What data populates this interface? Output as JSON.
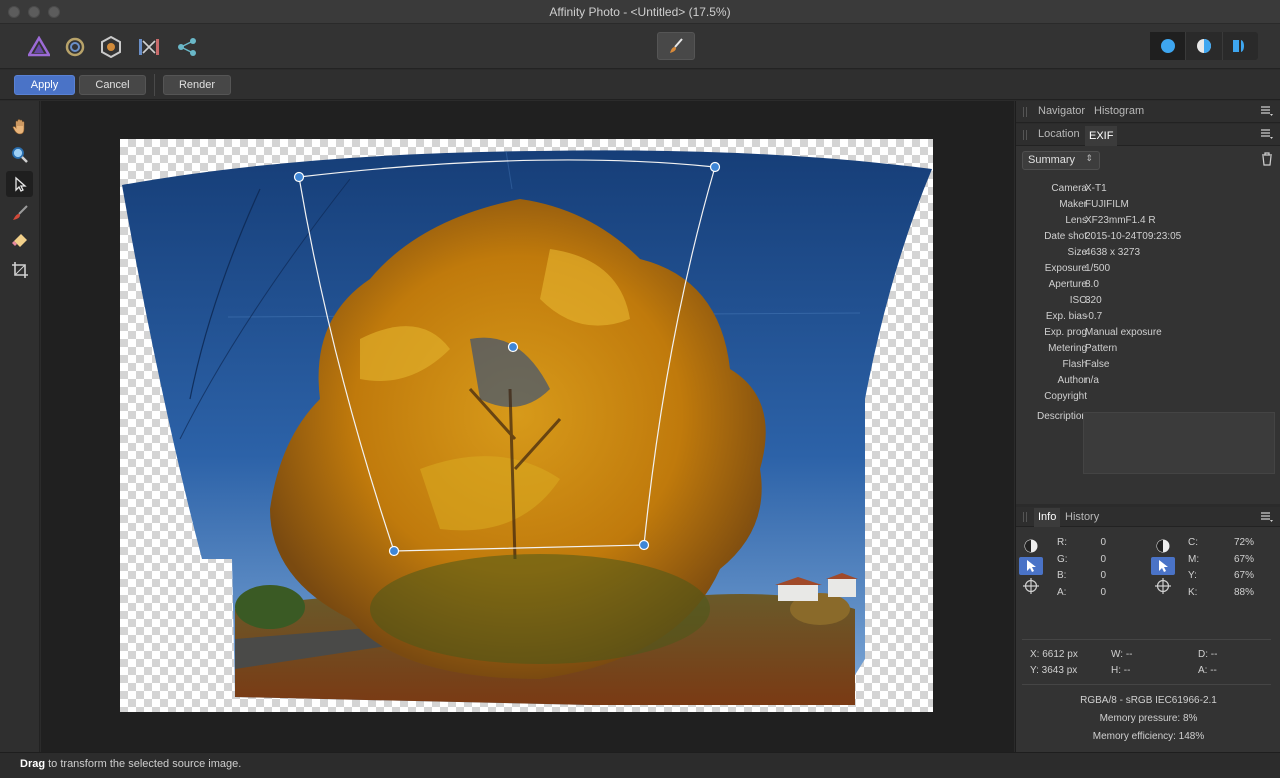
{
  "window": {
    "title": "Affinity Photo - <Untitled> (17.5%)"
  },
  "toolbar": {
    "personas": [
      "photo-persona-icon",
      "liquify-persona-icon",
      "develop-persona-icon",
      "tone-mapping-persona-icon",
      "export-persona-icon"
    ],
    "center_tool_icon": "brush-icon",
    "modes": [
      "single-source-mode-icon",
      "blend-mode-icon",
      "mask-mode-icon"
    ]
  },
  "context_toolbar": {
    "apply_label": "Apply",
    "cancel_label": "Cancel",
    "render_label": "Render"
  },
  "tools": [
    "hand-icon",
    "zoom-icon",
    "move-icon",
    "brush-icon",
    "eraser-icon",
    "crop-icon"
  ],
  "status": {
    "bold": "Drag",
    "text": " to transform the selected source image."
  },
  "panels": {
    "top_tabs": [
      "Navigator",
      "Histogram"
    ],
    "meta_tabs": [
      "Location",
      "EXIF"
    ],
    "summary_select": "Summary",
    "exif": [
      {
        "key": "Camera",
        "value": "X-T1"
      },
      {
        "key": "Maker",
        "value": "FUJIFILM"
      },
      {
        "key": "Lens",
        "value": "XF23mmF1.4 R"
      },
      {
        "key": "Date shot",
        "value": "2015-10-24T09:23:05"
      },
      {
        "key": "Size",
        "value": "4638 x 3273"
      },
      {
        "key": "Exposure",
        "value": "1/500"
      },
      {
        "key": "Aperture",
        "value": "8.0"
      },
      {
        "key": "ISO",
        "value": "320"
      },
      {
        "key": "Exp. bias",
        "value": "-0.7"
      },
      {
        "key": "Exp. prog",
        "value": "Manual exposure"
      },
      {
        "key": "Metering",
        "value": "Pattern"
      },
      {
        "key": "Flash",
        "value": "False"
      },
      {
        "key": "Author",
        "value": "n/a"
      },
      {
        "key": "Copyright",
        "value": ""
      }
    ],
    "description_label": "Description",
    "info_tabs": [
      "Info",
      "History"
    ],
    "rgb": [
      {
        "label": "R:",
        "value": "0"
      },
      {
        "label": "G:",
        "value": "0"
      },
      {
        "label": "B:",
        "value": "0"
      },
      {
        "label": "A:",
        "value": "0"
      }
    ],
    "cmyk": [
      {
        "label": "C:",
        "value": "72%"
      },
      {
        "label": "M:",
        "value": "67%"
      },
      {
        "label": "Y:",
        "value": "67%"
      },
      {
        "label": "K:",
        "value": "88%"
      }
    ],
    "coords": {
      "x": "X: 6612 px",
      "y": "Y: 3643 px",
      "w": "W: --",
      "h": "H: --",
      "d": "D: --",
      "a": "A: --"
    },
    "color_format": "RGBA/8 - sRGB IEC61966-2.1",
    "memory_pressure": "Memory pressure: 8%",
    "memory_efficiency": "Memory efficiency: 148%"
  },
  "colors": {
    "accent": "#4a73c7",
    "sky": "#1e4a86",
    "foliage": "#c8860e"
  }
}
